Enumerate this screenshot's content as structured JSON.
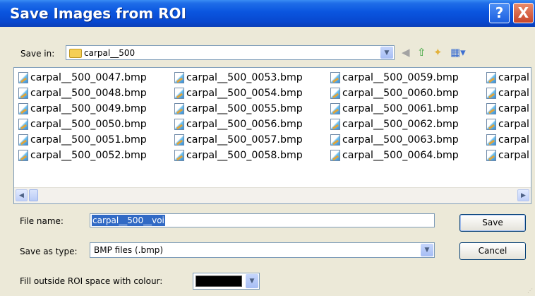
{
  "window": {
    "title": "Save Images from ROI",
    "help_label": "?",
    "close_label": "X"
  },
  "save_in": {
    "label": "Save in:",
    "folder": "carpal__500"
  },
  "toolbar": {
    "back_icon": "back-arrow-icon",
    "up_icon": "up-folder-icon",
    "new_folder_icon": "new-folder-icon",
    "views_icon": "views-menu-icon"
  },
  "files": [
    "carpal__500_0047.bmp",
    "carpal__500_0048.bmp",
    "carpal__500_0049.bmp",
    "carpal__500_0050.bmp",
    "carpal__500_0051.bmp",
    "carpal__500_0052.bmp",
    "carpal__500_0053.bmp",
    "carpal__500_0054.bmp",
    "carpal__500_0055.bmp",
    "carpal__500_0056.bmp",
    "carpal__500_0057.bmp",
    "carpal__500_0058.bmp",
    "carpal__500_0059.bmp",
    "carpal__500_0060.bmp",
    "carpal__500_0061.bmp",
    "carpal__500_0062.bmp",
    "carpal__500_0063.bmp",
    "carpal__500_0064.bmp",
    "carpal",
    "carpal",
    "carpal",
    "carpal",
    "carpal",
    "carpal"
  ],
  "file_name": {
    "label": "File name:",
    "value": "carpal__500__voi"
  },
  "save_as_type": {
    "label": "Save as type:",
    "value": "BMP files (.bmp)"
  },
  "fill": {
    "label": "Fill outside ROI space with colour:",
    "color": "#000000"
  },
  "buttons": {
    "save": "Save",
    "cancel": "Cancel"
  }
}
